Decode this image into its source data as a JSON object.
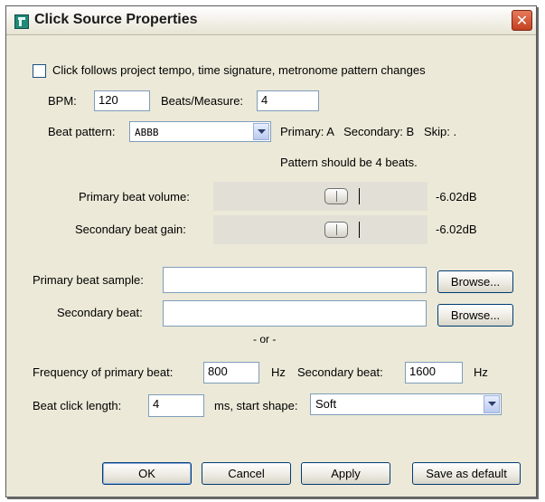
{
  "window": {
    "title": "Click Source Properties",
    "close_glyph": "✕"
  },
  "follow_checkbox": {
    "label": "Click follows project tempo, time signature, metronome pattern changes",
    "checked": false
  },
  "bpm": {
    "label": "BPM:",
    "value": "120"
  },
  "beats_per_measure": {
    "label": "Beats/Measure:",
    "value": "4"
  },
  "beat_pattern": {
    "label": "Beat pattern:",
    "value": "ABBB",
    "legend": "Primary: A   Secondary: B   Skip: .",
    "note": "Pattern should be 4 beats."
  },
  "primary_volume": {
    "label": "Primary beat volume:",
    "value": "-6.02dB"
  },
  "secondary_gain": {
    "label": "Secondary beat gain:",
    "value": "-6.02dB"
  },
  "primary_sample": {
    "label": "Primary beat sample:",
    "value": "",
    "browse_label": "Browse..."
  },
  "secondary_sample": {
    "label": "Secondary beat:",
    "value": "",
    "browse_label": "Browse..."
  },
  "or_label": "- or -",
  "frequency": {
    "label": "Frequency of primary beat:",
    "primary_value": "800",
    "unit": "Hz",
    "secondary_label": "Secondary beat:",
    "secondary_value": "1600",
    "secondary_unit": "Hz"
  },
  "click_length": {
    "label": "Beat click length:",
    "value": "4",
    "unit_shape_label": "ms, start shape:",
    "shape_value": "Soft"
  },
  "buttons": {
    "ok": "OK",
    "cancel": "Cancel",
    "apply": "Apply",
    "save_default": "Save as default"
  },
  "colors": {
    "dialog_bg": "#ece9d8",
    "close_button": "#c4401f",
    "field_border": "#7f9db9",
    "button_border": "#003c74"
  }
}
